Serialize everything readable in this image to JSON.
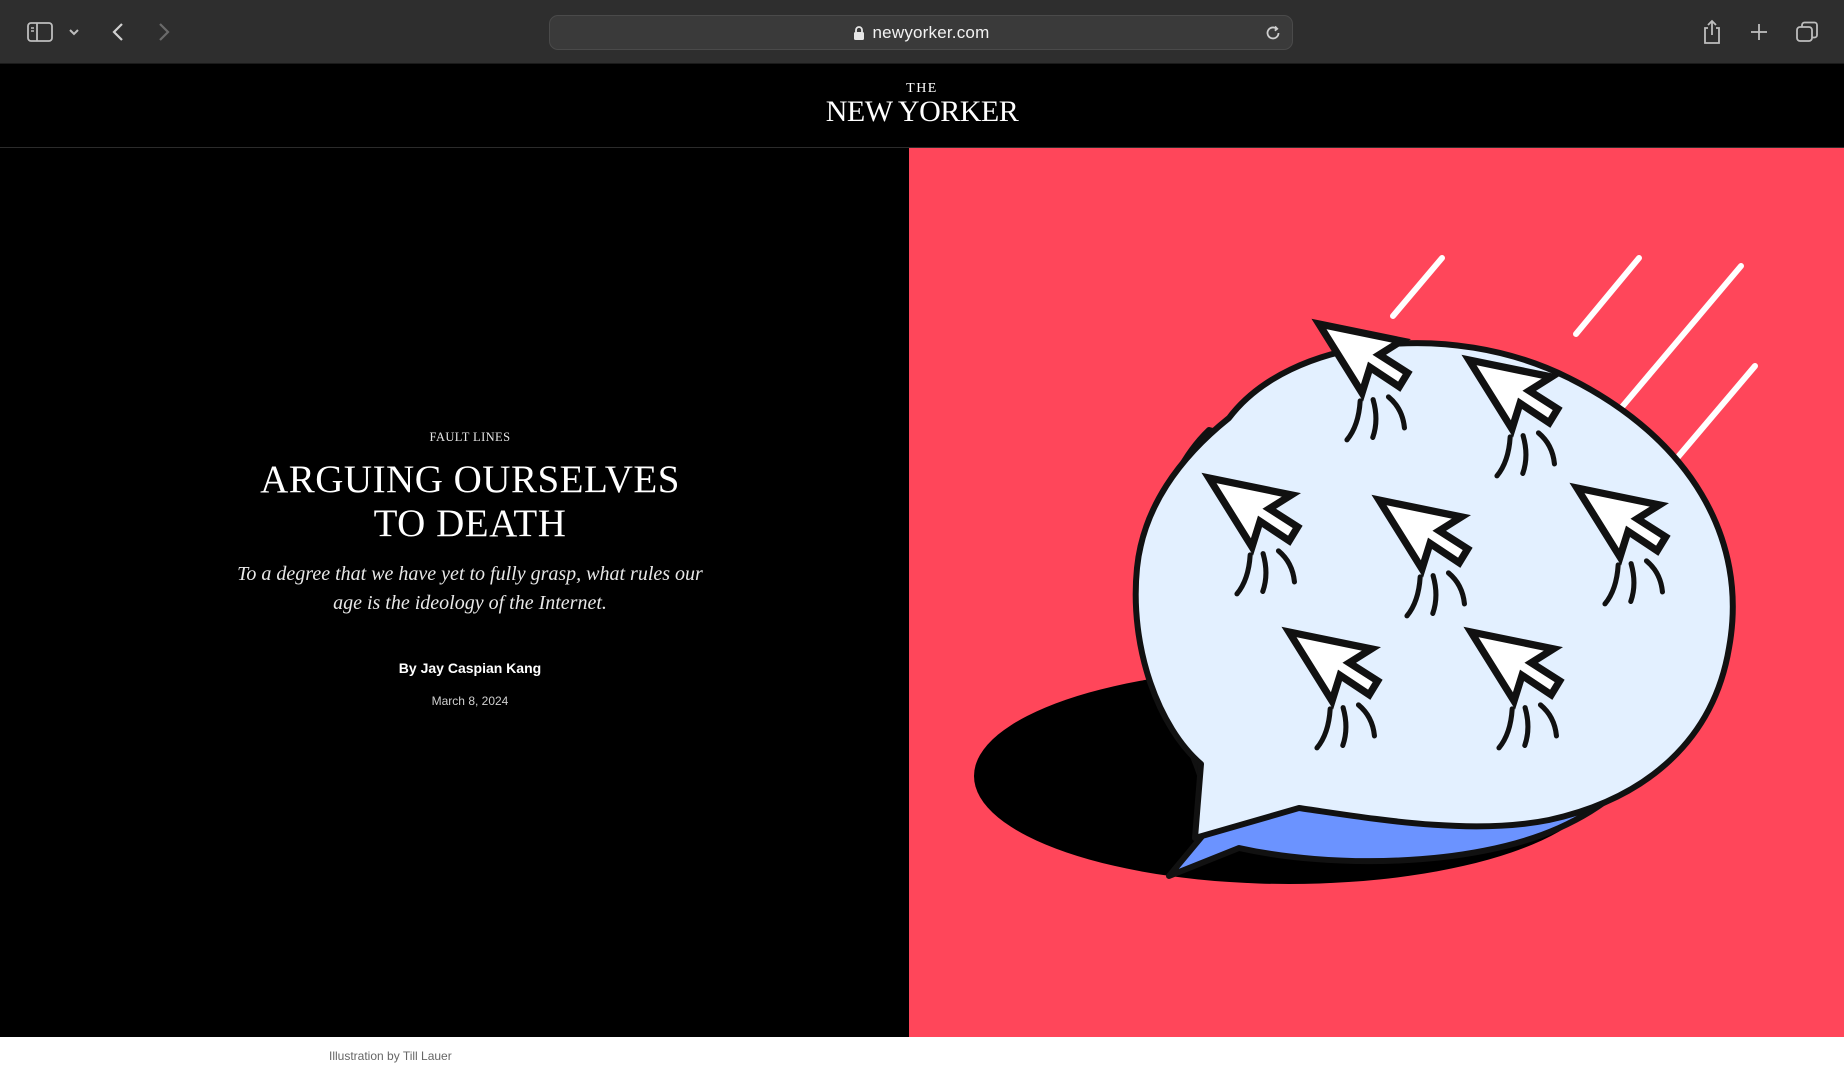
{
  "browser": {
    "url": "newyorker.com",
    "icons": [
      "sidebar-icon",
      "chevron-down-icon",
      "back-icon",
      "forward-icon",
      "lock-icon",
      "reload-icon",
      "share-icon",
      "plus-icon",
      "tabs-icon"
    ]
  },
  "site": {
    "logo_the": "THE",
    "logo_main": "NEW YORKER"
  },
  "article": {
    "rubric": "FAULT LINES",
    "headline_line1": "ARGUING OURSELVES",
    "headline_line2": "TO DEATH",
    "dek_line1": "To a degree that we have yet to fully grasp, what rules our",
    "dek_line2": "age is the ideology of the Internet.",
    "byline": "By Jay Caspian Kang",
    "date": "March 8, 2024"
  },
  "illustration": {
    "caption": "Illustration by Till Lauer",
    "colors": {
      "background": "#ff465a",
      "bubble": "#e3f0ff",
      "bubble_side": "#6b93ff",
      "shadow": "#000000"
    }
  }
}
